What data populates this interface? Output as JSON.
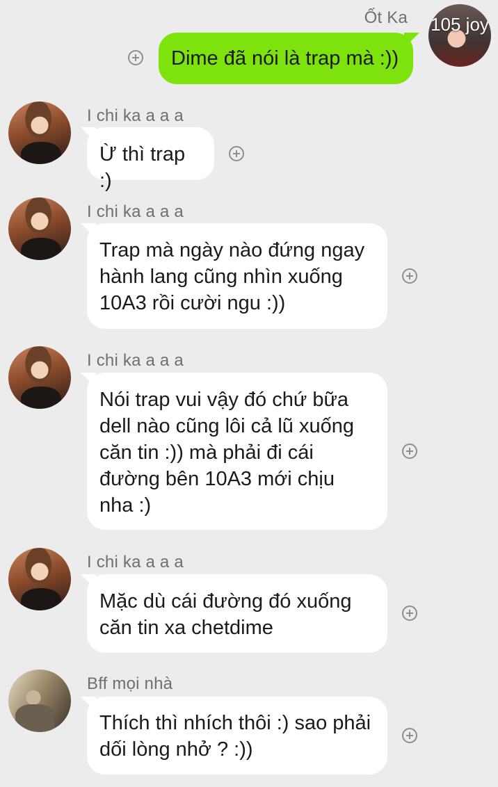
{
  "self": {
    "name": "Ốt Ka",
    "avatar_overlay_text": "105 joy"
  },
  "messages": [
    {
      "sender": "Ốt Ka",
      "lines": [
        "Dime đã nói là trap mà :))"
      ],
      "outgoing": true
    },
    {
      "sender": "I chi ka a a a",
      "lines": [
        "Ừ thì trap :)"
      ]
    },
    {
      "sender": "I chi ka a a a",
      "lines": [
        "Trap mà ngày nào đứng ngay",
        "hành lang cũng nhìn xuống",
        "10A3 rồi cười ngu :))"
      ]
    },
    {
      "sender": "I chi ka a a a",
      "lines": [
        "Nói trap vui vậy đó chứ bữa",
        "dell nào cũng lôi cả lũ xuống",
        "căn tin :)) mà phải đi cái",
        "đường bên 10A3 mới chịu",
        "nha :)"
      ]
    },
    {
      "sender": "I chi ka a a a",
      "lines": [
        "Mặc dù cái đường đó xuống",
        "căn tin xa chetdime"
      ]
    },
    {
      "sender": "Bff mọi nhà",
      "lines": [
        "Thích thì nhích thôi :) sao phải",
        "dối lòng nhở ? :))"
      ]
    }
  ],
  "colors": {
    "background": "#ececed",
    "outgoing_bubble": "#7ee20c",
    "incoming_bubble": "#ffffff",
    "name_text": "#6f6f6f"
  },
  "icons": {
    "reaction": "plus-circle-icon"
  }
}
